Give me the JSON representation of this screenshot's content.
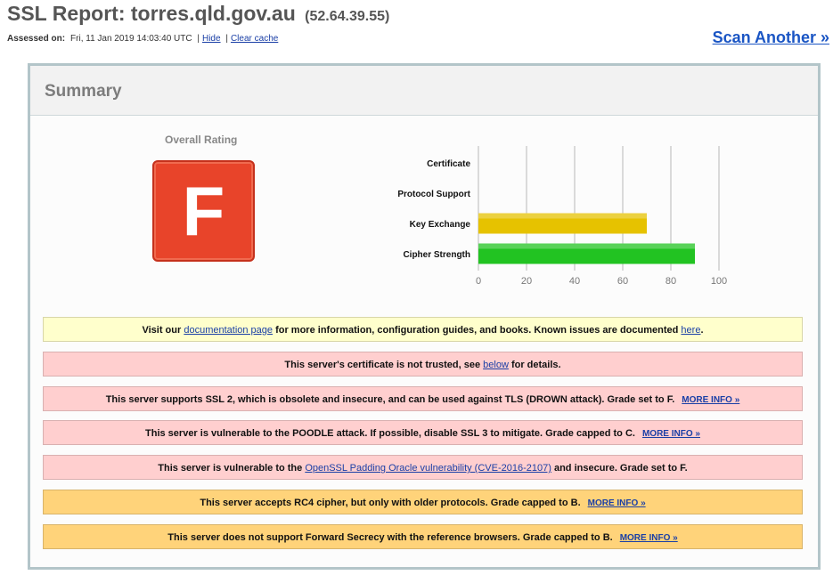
{
  "header": {
    "title_prefix": "SSL Report: ",
    "host": "torres.qld.gov.au",
    "ip": "(52.64.39.55)",
    "assessed_label": "Assessed on:",
    "assessed_value": "Fri, 11 Jan 2019 14:03:40 UTC",
    "sep1": "|",
    "hide_link": "Hide",
    "sep2": "|",
    "clear_cache_link": "Clear cache",
    "scan_another": "Scan Another »"
  },
  "summary": {
    "title": "Summary",
    "overall_rating_label": "Overall Rating",
    "grade": "F",
    "grade_color": "#e8442a"
  },
  "chart_data": {
    "type": "bar",
    "orientation": "horizontal",
    "categories": [
      "Certificate",
      "Protocol Support",
      "Key Exchange",
      "Cipher Strength"
    ],
    "values": [
      0,
      0,
      70,
      90
    ],
    "bar_colors": [
      "#cccccc",
      "#cccccc",
      "#e6c200",
      "#22c322"
    ],
    "xlim": [
      0,
      100
    ],
    "xticks": [
      0,
      20,
      40,
      60,
      80,
      100
    ],
    "grid": true
  },
  "messages": [
    {
      "type": "yellow",
      "pre": "Visit our ",
      "link": "documentation page",
      "mid": " for more information, configuration guides, and books. Known issues are documented ",
      "link2": "here",
      "post": "."
    },
    {
      "type": "red",
      "pre": "This server's certificate is not trusted, see ",
      "link": "below",
      "post": " for details."
    },
    {
      "type": "red",
      "pre": "This server supports SSL 2, which is obsolete and insecure, and can be used against TLS (DROWN attack). Grade set to F.",
      "more": "MORE INFO »"
    },
    {
      "type": "red",
      "pre": "This server is vulnerable to the POODLE attack. If possible, disable SSL 3 to mitigate. Grade capped to C.",
      "more": "MORE INFO »"
    },
    {
      "type": "red",
      "pre": "This server is vulnerable to the ",
      "link": "OpenSSL Padding Oracle vulnerability (CVE-2016-2107)",
      "post": " and insecure. Grade set to F."
    },
    {
      "type": "orange",
      "pre": "This server accepts RC4 cipher, but only with older protocols. Grade capped to B.",
      "more": "MORE INFO »"
    },
    {
      "type": "orange",
      "pre": "This server does not support Forward Secrecy with the reference browsers. Grade capped to B.",
      "more": "MORE INFO »"
    }
  ]
}
